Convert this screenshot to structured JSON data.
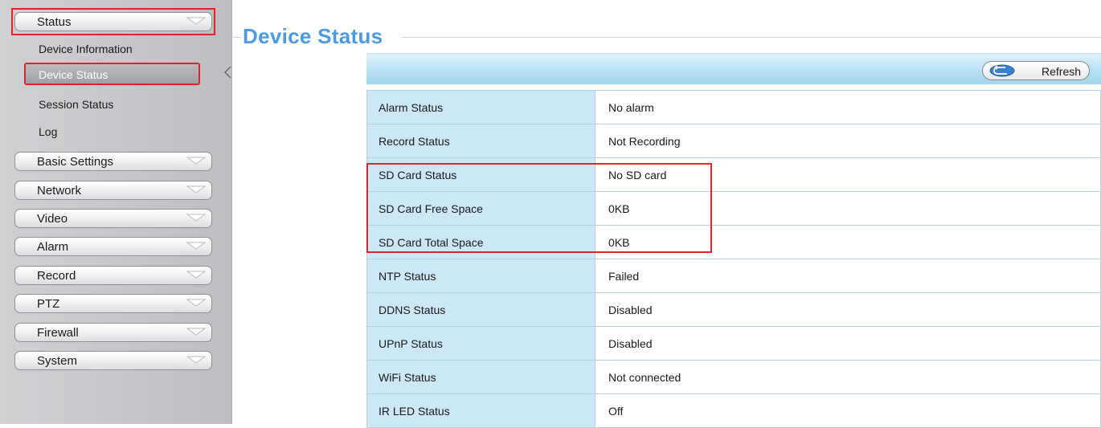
{
  "sidebar": {
    "status_menu": {
      "label": "Status",
      "icon": "chevron-down-icon"
    },
    "sub_items": [
      {
        "label": "Device Information"
      },
      {
        "label": "Device Status",
        "active": true
      },
      {
        "label": "Session Status"
      },
      {
        "label": "Log"
      }
    ],
    "menus": [
      {
        "label": "Basic Settings"
      },
      {
        "label": "Network"
      },
      {
        "label": "Video"
      },
      {
        "label": "Alarm"
      },
      {
        "label": "Record"
      },
      {
        "label": "PTZ"
      },
      {
        "label": "Firewall"
      },
      {
        "label": "System"
      }
    ]
  },
  "main": {
    "title": "Device Status",
    "refresh_label": "Refresh",
    "rows": [
      {
        "key": "Alarm Status",
        "value": "No alarm"
      },
      {
        "key": "Record Status",
        "value": "Not Recording"
      },
      {
        "key": "SD Card Status",
        "value": "No SD card"
      },
      {
        "key": "SD Card Free Space",
        "value": "0KB"
      },
      {
        "key": "SD Card Total Space",
        "value": "0KB"
      },
      {
        "key": "NTP Status",
        "value": "Failed"
      },
      {
        "key": "DDNS Status",
        "value": "Disabled"
      },
      {
        "key": "UPnP Status",
        "value": "Disabled"
      },
      {
        "key": "WiFi Status",
        "value": "Not connected"
      },
      {
        "key": "IR LED Status",
        "value": "Off"
      }
    ]
  },
  "colors": {
    "accent": "#4a9be4",
    "highlight": "#e0222b",
    "key_cell": "#cce8f7"
  }
}
